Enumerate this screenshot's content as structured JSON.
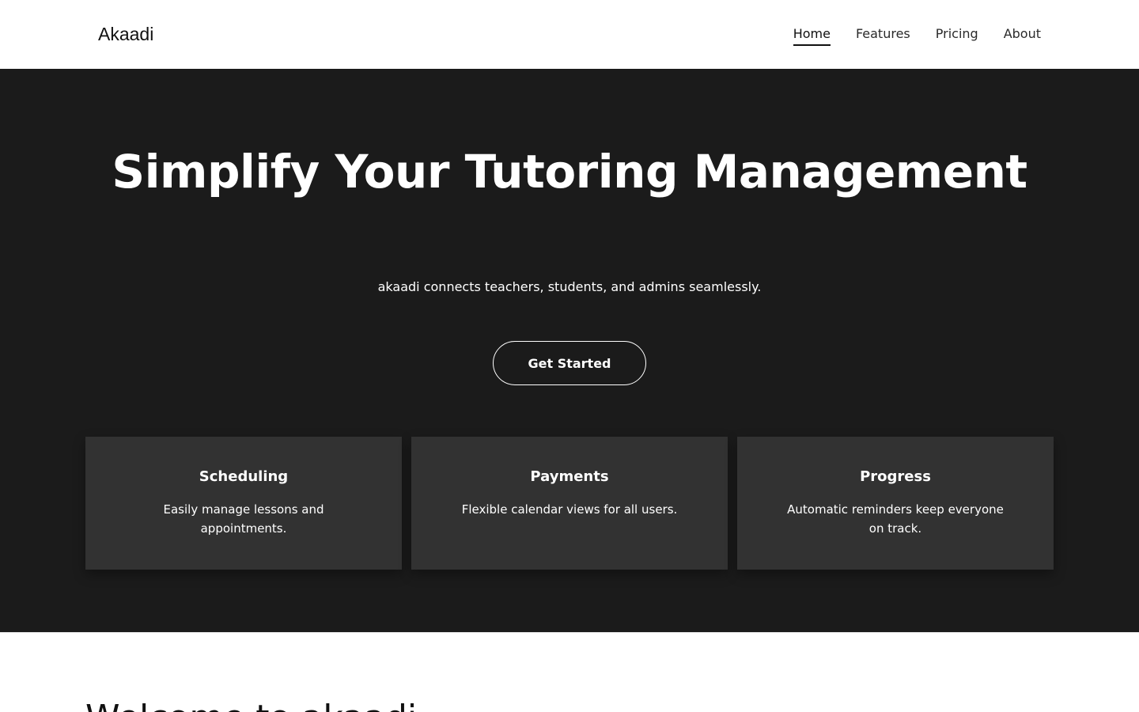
{
  "header": {
    "logo": "Akaadi",
    "nav": [
      {
        "label": "Home",
        "active": true
      },
      {
        "label": "Features",
        "active": false
      },
      {
        "label": "Pricing",
        "active": false
      },
      {
        "label": "About",
        "active": false
      }
    ]
  },
  "hero": {
    "title": "Simplify Your Tutoring Management",
    "subtitle": "akaadi connects teachers, students, and admins seamlessly.",
    "cta_label": "Get Started"
  },
  "features": [
    {
      "title": "Scheduling",
      "description": "Easily manage lessons and appointments."
    },
    {
      "title": "Payments",
      "description": "Flexible calendar views for all users."
    },
    {
      "title": "Progress",
      "description": "Automatic reminders keep everyone on track."
    }
  ],
  "welcome": {
    "title": "Welcome to akaadi"
  },
  "colors": {
    "hero_background": "#1b1b1b",
    "card_background": "#323232",
    "header_background": "#ffffff",
    "text_light": "#ffffff",
    "text_dark": "#111111"
  }
}
